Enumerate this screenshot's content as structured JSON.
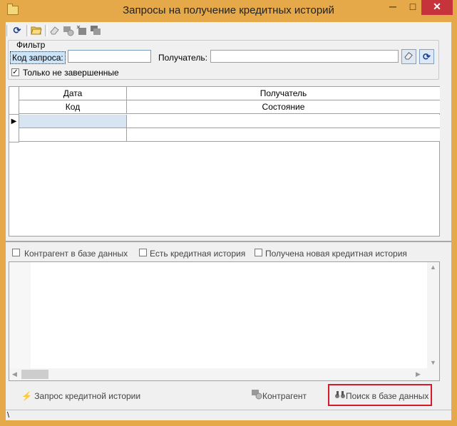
{
  "window": {
    "title": "Запросы на получение кредитных историй",
    "minimize": "─",
    "maximize": "□",
    "close": "✕"
  },
  "toolbar": {
    "icons": [
      "refresh-icon",
      "open-folder-icon",
      "eraser-icon",
      "contractor-icon",
      "grid-icon",
      "copy-icon"
    ]
  },
  "filter": {
    "legend": "Фильтр",
    "code_label": "Код запроса:",
    "code_value": "",
    "recipient_label": "Получатель:",
    "recipient_value": "",
    "only_unfinished_label": "Только не завершенные",
    "only_unfinished_checked": true
  },
  "grid": {
    "headers_row1": [
      "Дата",
      "Получатель"
    ],
    "headers_row2": [
      "Код",
      "Состояние"
    ],
    "row_indicator": "▶"
  },
  "options": {
    "contractor_in_db": "Контрагент в базе данных",
    "has_credit_history": "Есть кредитная история",
    "new_credit_history": "Получена новая кредитная история"
  },
  "buttons": {
    "request_credit_history": "Запрос кредитной истории",
    "contractor": "Контрагент",
    "search_db": "Поиск в базе данных"
  },
  "status": {
    "text": "\\"
  }
}
